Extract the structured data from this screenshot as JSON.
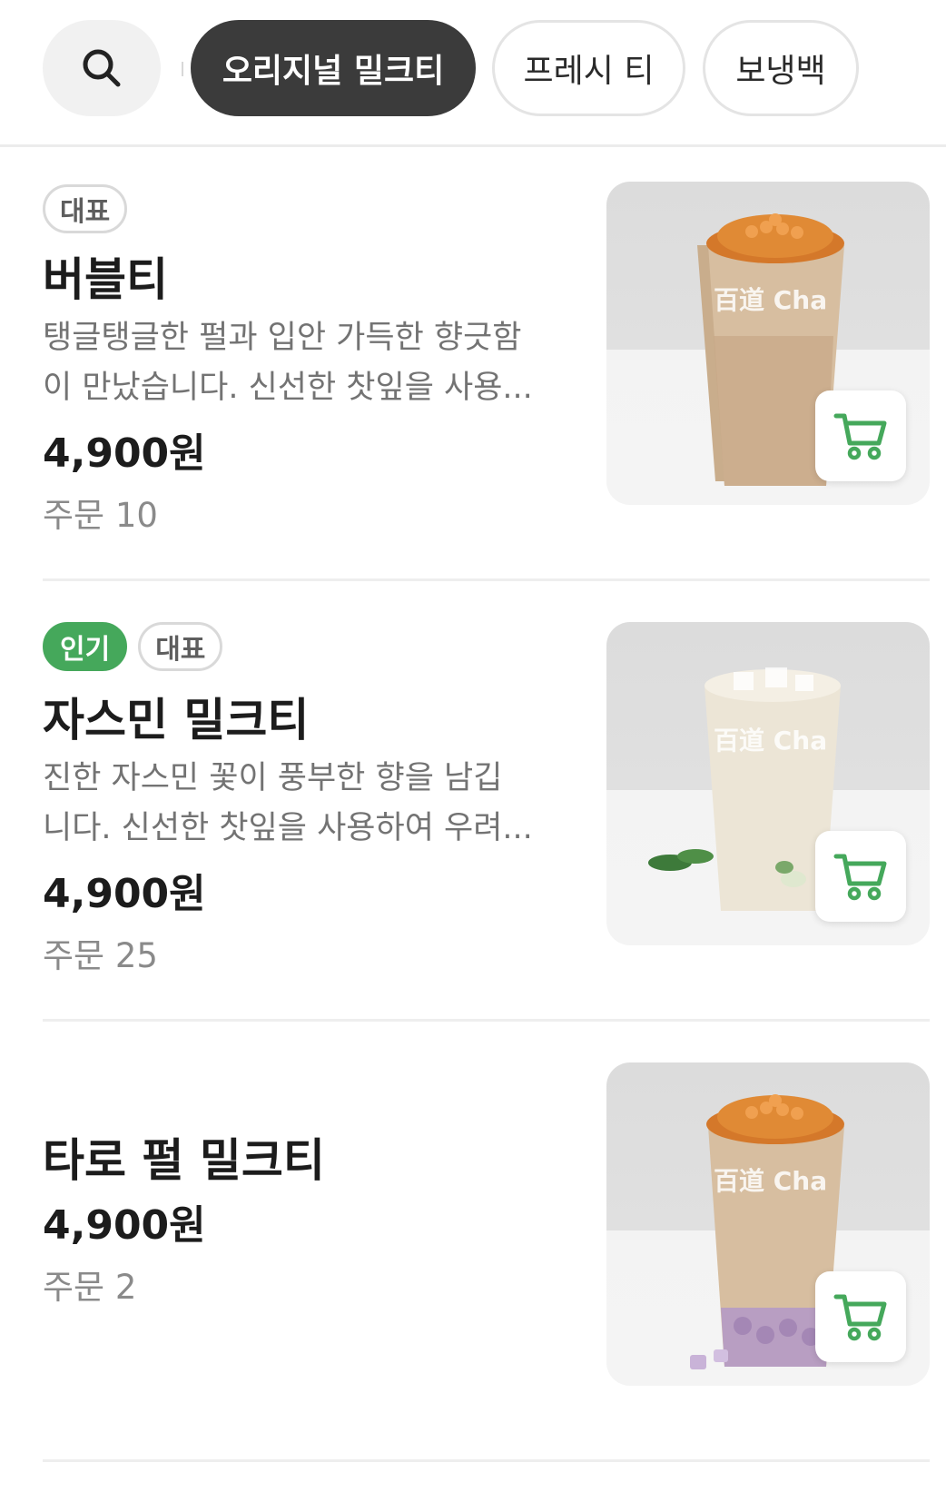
{
  "search": {
    "icon": "search-icon"
  },
  "categories": [
    {
      "label": "오리지널 밀크티",
      "active": true
    },
    {
      "label": "프레시 티",
      "active": false
    },
    {
      "label": "보냉백",
      "active": false
    }
  ],
  "items": [
    {
      "badges": [
        "대표"
      ],
      "name": "버블티",
      "desc_lines": [
        "탱글탱글한 펄과 입안 가득한 향긋함",
        "이 만났습니다. 신선한 찻잎을 사용..."
      ],
      "price": "4,900원",
      "orders": "주문 10",
      "cup_text": "百道 Cha"
    },
    {
      "badges": [
        "인기",
        "대표"
      ],
      "name": "자스민 밀크티",
      "desc_lines": [
        "진한 자스민 꽃이 풍부한 향을 남깁",
        "니다. 신선한 찻잎을 사용하여 우려..."
      ],
      "price": "4,900원",
      "orders": "주문 25",
      "cup_text": "百道 Cha"
    },
    {
      "badges": [],
      "name": "타로 펄 밀크티",
      "desc_lines": [],
      "price": "4,900원",
      "orders": "주문 2",
      "cup_text": "百道 Cha"
    }
  ],
  "colors": {
    "accent_green": "#45a85b",
    "active_chip": "#3b3b3b"
  }
}
